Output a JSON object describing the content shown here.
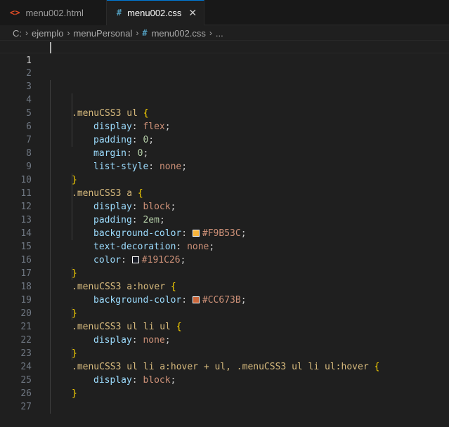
{
  "tabs": [
    {
      "label": "menu002.html",
      "icon": "<>",
      "icon_color": "#e44d26",
      "active": false
    },
    {
      "label": "menu002.css",
      "icon": "#",
      "icon_color": "#519aba",
      "active": true,
      "close": "✕"
    }
  ],
  "breadcrumb": {
    "drive": "C:",
    "folder1": "ejemplo",
    "folder2": "menuPersonal",
    "file": "menu002.css",
    "more": "...",
    "sep": "›"
  },
  "editor": {
    "current_line": 1,
    "line_numbers": [
      "1",
      "2",
      "3",
      "4",
      "5",
      "6",
      "7",
      "8",
      "9",
      "10",
      "11",
      "12",
      "13",
      "14",
      "15",
      "16",
      "17",
      "18",
      "19",
      "20",
      "21",
      "22",
      "23",
      "24",
      "25",
      "26",
      "27"
    ],
    "lines": [
      "",
      "",
      "",
      ".menuCSS3 ul {",
      "display: flex;",
      "padding: 0;",
      "margin: 0;",
      "list-style: none;",
      "}",
      ".menuCSS3 a {",
      "display: block;",
      "padding: 2em;",
      "background-color: #F9B53C;",
      "text-decoration: none;",
      "color: #191C26;",
      "}",
      ".menuCSS3 a:hover {",
      "background-color: #CC673B;",
      "}",
      ".menuCSS3 ul li ul {",
      "display: none;",
      "}",
      ".menuCSS3 ul li a:hover + ul, .menuCSS3 ul li ul:hover {",
      "display: block;",
      "}",
      "",
      ""
    ],
    "colors": {
      "selector": "#d7ba7d",
      "brace": "#ffd700",
      "property": "#9cdcfe",
      "value": "#ce9178",
      "number": "#b5cea8",
      "swatch_1": "#F9B53C",
      "swatch_2": "#191C26",
      "swatch_3": "#CC673B"
    }
  }
}
